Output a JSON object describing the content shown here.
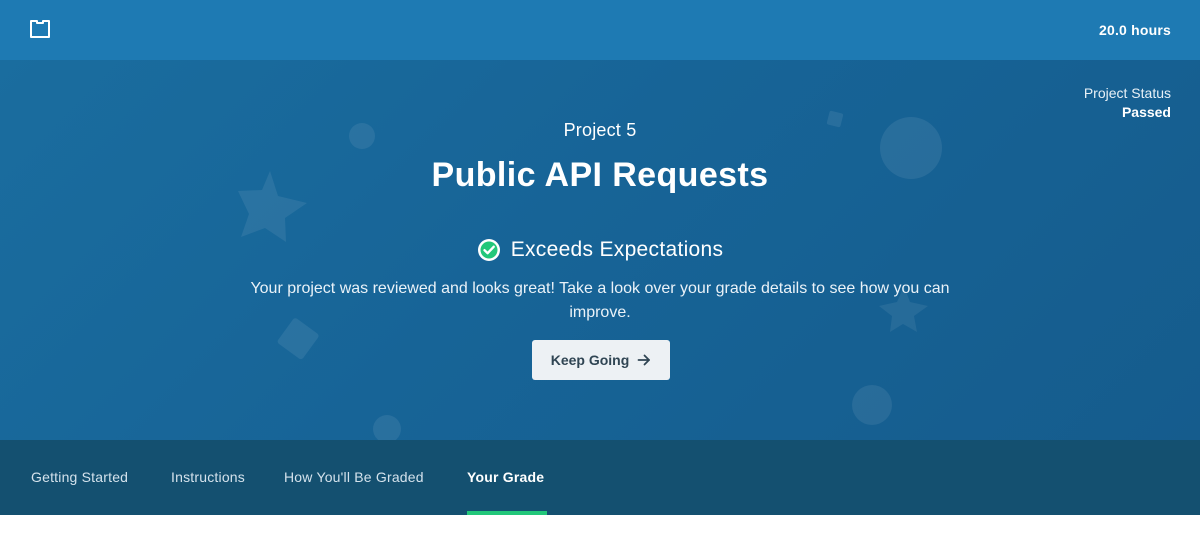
{
  "topbar": {
    "icon": "folder-icon",
    "hours_text": "20.0 hours"
  },
  "hero": {
    "status_label": "Project Status",
    "status_value": "Passed",
    "project_number": "Project 5",
    "project_title": "Public API Requests",
    "grade_icon": "check-circle-icon",
    "grade_text": "Exceeds Expectations",
    "message": "Your project was reviewed and looks great! Take a look over your grade details to see how you can improve.",
    "button_label": "Keep Going",
    "button_icon": "arrow-right-icon"
  },
  "tabs": [
    {
      "label": "Getting Started",
      "active": false
    },
    {
      "label": "Instructions",
      "active": false
    },
    {
      "label": "How You'll Be Graded",
      "active": false
    },
    {
      "label": "Your Grade",
      "active": true
    }
  ],
  "colors": {
    "topbar": "#1e7ab3",
    "hero": "#176497",
    "tabs": "#145070",
    "success": "#22c77a",
    "button": "#edf1f4"
  }
}
